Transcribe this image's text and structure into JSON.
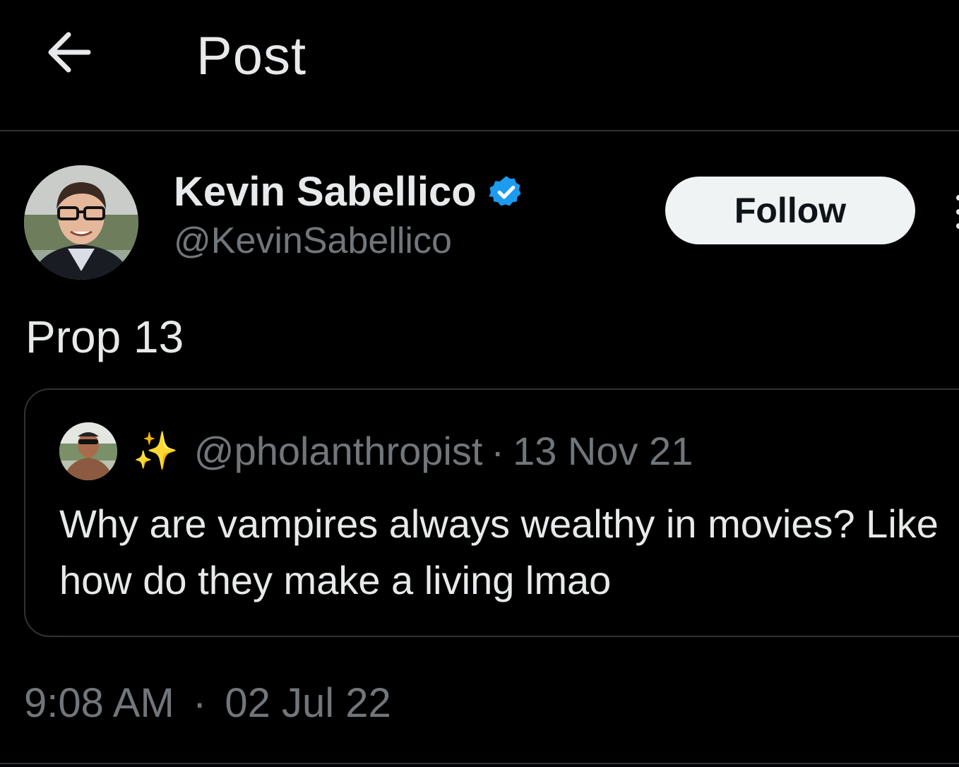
{
  "header": {
    "title": "Post",
    "back_icon": "arrow-left-icon"
  },
  "author": {
    "display_name": "Kevin Sabellico",
    "handle": "@KevinSabellico",
    "verified": true,
    "verified_color": "#1d9bf0"
  },
  "follow_button": {
    "label": "Follow"
  },
  "post": {
    "text": "Prop 13"
  },
  "quoted_post": {
    "emoji": "✨",
    "handle": "@pholanthropist",
    "separator": "·",
    "date": "13 Nov 21",
    "text": "Why are vampires always wealthy in movies? Like how do they make a living lmao"
  },
  "meta": {
    "time": "9:08 AM",
    "separator": "·",
    "date": "02 Jul 22"
  },
  "colors": {
    "background": "#000000",
    "text": "#e7e9ea",
    "muted": "#71767b",
    "border": "#2f3336"
  }
}
